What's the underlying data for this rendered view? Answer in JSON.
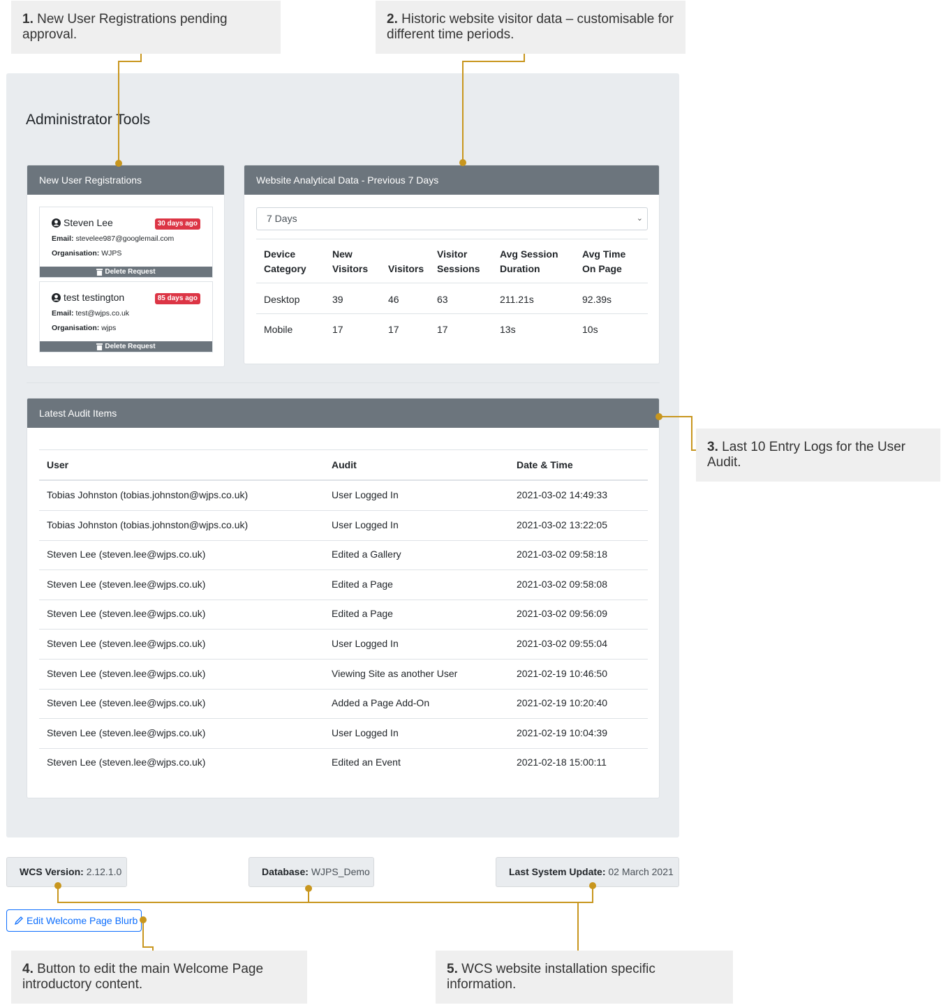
{
  "callouts": [
    {
      "num": "1.",
      "text": "New User Registrations pending approval."
    },
    {
      "num": "2.",
      "text": "Historic website visitor data – customisable for different time periods."
    },
    {
      "num": "3.",
      "text": "Last 10 Entry Logs for the User Audit."
    },
    {
      "num": "4.",
      "text": "Button to edit the main Welcome Page introductory content."
    },
    {
      "num": "5.",
      "text": "WCS website installation specific information."
    }
  ],
  "admin": {
    "title": "Administrator Tools"
  },
  "registrations": {
    "header": "New User Registrations",
    "email_label": "Email:",
    "org_label": "Organisation:",
    "delete_label": "Delete Request",
    "items": [
      {
        "name": "Steven Lee",
        "badge": "30 days ago",
        "email": "stevelee987@googlemail.com",
        "organisation": "WJPS"
      },
      {
        "name": "test testington",
        "badge": "85 days ago",
        "email": "test@wjps.co.uk",
        "organisation": "wjps"
      }
    ]
  },
  "analytics": {
    "header": "Website Analytical Data - Previous 7 Days",
    "period_select": "7 Days",
    "columns": [
      [
        "Device",
        "Category"
      ],
      [
        "New",
        "Visitors"
      ],
      [
        "",
        "Visitors"
      ],
      [
        "Visitor",
        "Sessions"
      ],
      [
        "Avg Session",
        "Duration"
      ],
      [
        "Avg Time",
        "On Page"
      ]
    ],
    "rows": [
      [
        "Desktop",
        "39",
        "46",
        "63",
        "211.21s",
        "92.39s"
      ],
      [
        "Mobile",
        "17",
        "17",
        "17",
        "13s",
        "10s"
      ]
    ]
  },
  "audit": {
    "header": "Latest Audit Items",
    "columns": [
      "User",
      "Audit",
      "Date & Time"
    ],
    "rows": [
      [
        "Tobias Johnston (tobias.johnston@wjps.co.uk)",
        "User Logged In",
        "2021-03-02 14:49:33"
      ],
      [
        "Tobias Johnston (tobias.johnston@wjps.co.uk)",
        "User Logged In",
        "2021-03-02 13:22:05"
      ],
      [
        "Steven Lee (steven.lee@wjps.co.uk)",
        "Edited a Gallery",
        "2021-03-02 09:58:18"
      ],
      [
        "Steven Lee (steven.lee@wjps.co.uk)",
        "Edited a Page",
        "2021-03-02 09:58:08"
      ],
      [
        "Steven Lee (steven.lee@wjps.co.uk)",
        "Edited a Page",
        "2021-03-02 09:56:09"
      ],
      [
        "Steven Lee (steven.lee@wjps.co.uk)",
        "User Logged In",
        "2021-03-02 09:55:04"
      ],
      [
        "Steven Lee (steven.lee@wjps.co.uk)",
        "Viewing Site as another User",
        "2021-02-19 10:46:50"
      ],
      [
        "Steven Lee (steven.lee@wjps.co.uk)",
        "Added a Page Add-On",
        "2021-02-19 10:20:40"
      ],
      [
        "Steven Lee (steven.lee@wjps.co.uk)",
        "User Logged In",
        "2021-02-19 10:04:39"
      ],
      [
        "Steven Lee (steven.lee@wjps.co.uk)",
        "Edited an Event",
        "2021-02-18 15:00:11"
      ]
    ]
  },
  "footer": {
    "version_label": "WCS Version:",
    "version_value": "2.12.1.0",
    "database_label": "Database:",
    "database_value": "WJPS_Demo",
    "update_label": "Last System Update:",
    "update_value": "02 March 2021",
    "edit_button": "Edit Welcome Page Blurb"
  },
  "colors": {
    "connector": "#c8961e",
    "header_bg": "#6c757d",
    "badge_bg": "#dc3545",
    "primary": "#0d6efd"
  },
  "icons": {
    "user": "user-circle-icon",
    "delete": "trash-icon",
    "edit": "pencil-icon",
    "select": "chevron-down-icon"
  }
}
